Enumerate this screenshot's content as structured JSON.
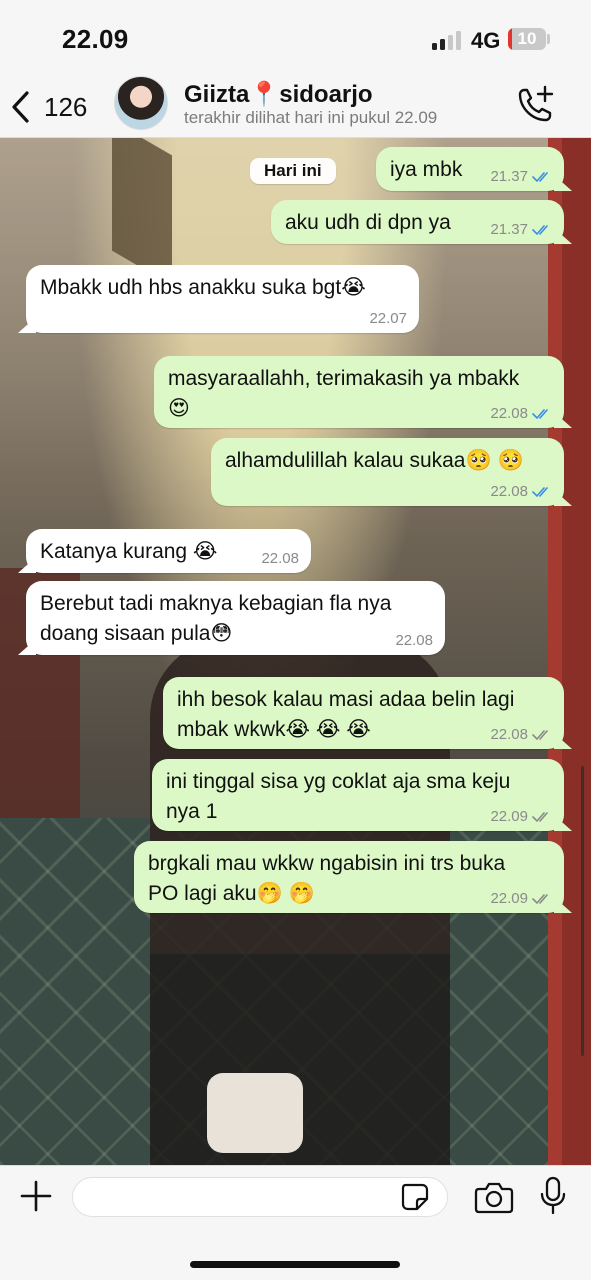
{
  "status_bar": {
    "time": "22.09",
    "network": "4G",
    "battery": "10",
    "battery_level": 0.1,
    "signal_bars": 2,
    "signal_total": 4
  },
  "header": {
    "back_count": "126",
    "contact_name": "Giizta",
    "contact_pin": "📍",
    "contact_location": "sidoarjo",
    "last_seen": "terakhir dilihat hari ini pukul 22.09"
  },
  "chat": {
    "day_label": "Hari ini",
    "messages": [
      {
        "dir": "out",
        "text": "iya mbk",
        "time": "21.37",
        "status": "read"
      },
      {
        "dir": "out",
        "text": "aku udh di dpn ya",
        "time": "21.37",
        "status": "read"
      },
      {
        "dir": "in",
        "text": "Mbakk udh hbs anakku suka bgt😭",
        "time": "22.07"
      },
      {
        "dir": "out",
        "text": "masyaraallahh, terimakasih ya mbakk 😍",
        "time": "22.08",
        "status": "read"
      },
      {
        "dir": "out",
        "text": "alhamdulillah kalau sukaa🥺 🥺",
        "time": "22.08",
        "status": "read"
      },
      {
        "dir": "in",
        "text": "Katanya kurang 😭",
        "time": "22.08"
      },
      {
        "dir": "in",
        "text": "Berebut tadi maknya kebagian fla nya doang sisaan pula😳",
        "time": "22.08"
      },
      {
        "dir": "out",
        "text": "ihh besok kalau masi adaa belin lagi mbak wkwk😭 😭 😭",
        "time": "22.08",
        "status": "delivered"
      },
      {
        "dir": "out",
        "text": "ini tinggal sisa yg coklat aja sma keju nya 1",
        "time": "22.09",
        "status": "delivered"
      },
      {
        "dir": "out",
        "text": "brgkali mau wkkw ngabisin ini trs buka PO lagi aku🤭 🤭",
        "time": "22.09",
        "status": "delivered"
      }
    ]
  },
  "input": {
    "value": "",
    "placeholder": ""
  },
  "colors": {
    "outgoing": "#dcf8c7",
    "incoming": "#ffffff",
    "read_tick": "#3a8ee6",
    "delivered_tick": "#8a8a8a"
  },
  "icons": [
    "back-chevron-icon",
    "add-call-icon",
    "plus-icon",
    "sticker-icon",
    "camera-icon",
    "mic-icon"
  ]
}
